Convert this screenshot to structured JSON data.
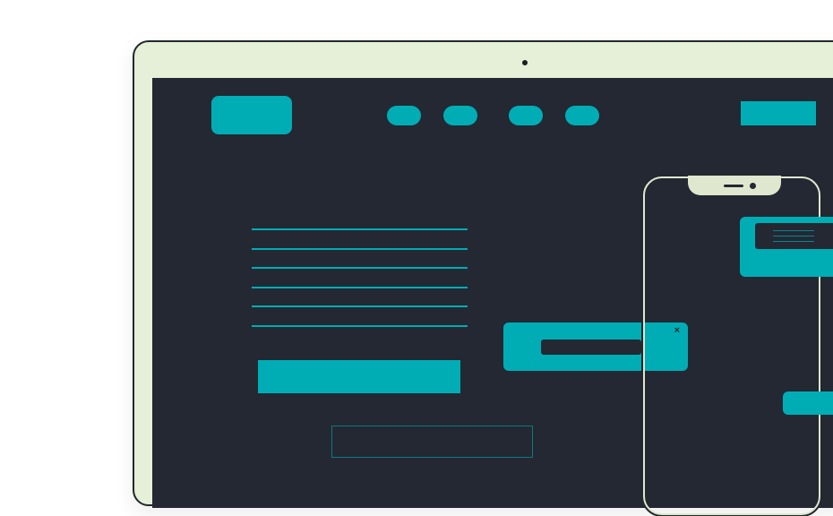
{
  "colors": {
    "accent": "#00adb5",
    "screen": "#232833",
    "bezel": "#e6efd7",
    "phone_frame": "#dfe7cf"
  },
  "illustration": {
    "nav_pills_count": 4,
    "text_lines_count": 6
  },
  "icons": {
    "close": "close-icon"
  },
  "popup": {
    "close_glyph": "×"
  }
}
